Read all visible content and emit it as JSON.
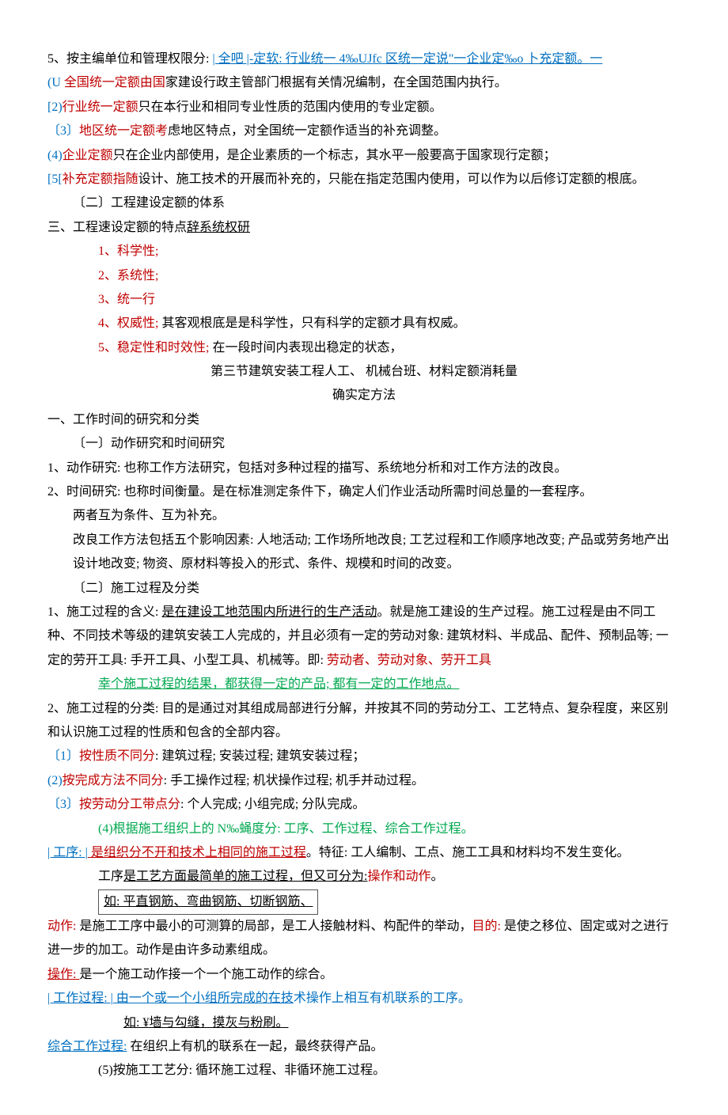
{
  "p5_lead": "5、按主编单位和管理权限分: ",
  "p5_link": "| 全吧 |-定软: 行业统一 4‰UJfc 区统一定说\"一企业定‰o 卜充定额。一",
  "p5_1a": "(U ",
  "p5_1b": "全国统一定额由国",
  "p5_1c": "家建设行政主管部门根据有关情况编制，在全国范围内执行。",
  "p5_2a": "[2)",
  "p5_2b": "行业统一定额",
  "p5_2c": "只在本行业和相同专业性质的范围内使用的专业定额。",
  "p5_3a": "〔3〕",
  "p5_3b": "地区统一定额考",
  "p5_3c": "虑地区特点，对全国统一定额作适当的补充调整。",
  "p5_4a": "(4)",
  "p5_4b": "企业定额",
  "p5_4c": "只在企业内部使用，是企业素质的一个标志，其水平一般要高于国家现行定额；",
  "p5_5a": "[5[",
  "p5_5b": "补充定额指随",
  "p5_5c": "设计、施工技术的开展而补充的，只能在指定范围内使用，可以作为以后修订定额的根底。",
  "sec2": "〔二〕工程建设定额的体系",
  "sec3a": "三、工程速设定额的特点",
  "sec3b": "辞系统权研",
  "pt1a": "1、科学性; ",
  "pt2a": "2、系统性; ",
  "pt3a": "3、统一行",
  "pt4a": "4、权威性; ",
  "pt4b": "其客观根底是是科学性，只有科学的定额才具有权威。",
  "pt5a": "5、稳定性和时效性; ",
  "pt5b": "在一段时间内表现出稳定的状态，",
  "title1": "第三节建筑安装工程人工、 机械台班、材料定额消耗量",
  "title2": "确实定方法",
  "s1": "一、工作时间的研究和分类",
  "s1_1": "〔一〕动作研究和时间研究",
  "s1_p1": "1、动作研究: 也称工作方法研究，包括对多种过程的描写、系统地分析和对工作方法的改良。",
  "s1_p2": "2、时间研究: 也称时间衡量。是在标准测定条件下，确定人们作业活动所需时间总量的一套程序。",
  "s1_p3": "两者互为条件、互为补充。",
  "s1_p4": "改良工作方法包括五个影响因素: 人地活动; 工作场所地改良; 工艺过程和工作顺序地改变; 产品或劳务地产出设计地改变; 物资、原材料等投入的形式、条件、规模和时间的改变。",
  "s1_2": "〔二〕施工过程及分类",
  "s2_p1a": "1、施工过程的含义: ",
  "s2_p1b": "是在建设工地范围内所进行的生产活动",
  "s2_p1c": "。就是施工建设的生产过程。施工过程是由不同工种、不同技术等级的建筑安装工人完成的，并且必须有一定的劳动对象: 建筑材料、半成品、配件、预制品等; 一定的劳开工具: 手开工具、小型工具、机械等。即: ",
  "s2_p1d": "劳动者、劳动对象、劳开工具",
  "s2_p2": "幸个施工过程的结果，都获得一定的产品; 都有一定的工作地点。",
  "s2_p3": "2、施工过程的分类: 目的是通过对其组成局部进行分解，并按其不同的劳动分工、工艺特点、复杂程度，来区别和认识施工过程的性质和包含的全部内容。",
  "s2_c1a": "〔1〕",
  "s2_c1b": "按性质不同分",
  "s2_c1c": ": 建筑过程; 安装过程; 建筑安装过程；",
  "s2_c2a": "(2)",
  "s2_c2b": "按完成方法不同分",
  "s2_c2c": ": 手工操作过程; 机状操作过程; 机手并动过程。",
  "s2_c3a": "〔3〕",
  "s2_c3b": "按劳动分工带点分",
  "s2_c3c": ": 个人完成; 小组完成; 分队完成。",
  "s2_c4a": "(4)根据施工组织上的 N‰蝇度分: ",
  "s2_c4b": "工序、工作过程、综合工作过程。",
  "gx_a": "| 工序: |",
  "gx_b": " 是组织分不开和技术上相同的施工过程",
  "gx_c": "。特征: 工人编制、工点、施工工具和材料均不发生变化。",
  "gx_d1": "工序",
  "gx_d2": "是工艺方面最简单的施工过程，但又可分为:",
  "gx_d3": "操作和动作",
  "gx_d4": "。",
  "gx_box": "如: 平直钢筋、弯曲钢筋、切断钢筋、",
  "dz_a": "动作: ",
  "dz_b": "是施工工序中最小的可测算的局部，是工人接触材料、构配件的举动，",
  "dz_c": "目的: ",
  "dz_d": "是使之移位、固定或对之进行进一步的加工。动作是由许多动素组成。",
  "cz_a": "操作: ",
  "cz_b": "是一个施工动作接一个一个施工动作的综合。",
  "gzgc_a": "| 工作过程: |",
  "gzgc_b": " 由一个或一个小组所完成的在技",
  "gzgc_c": "术操作上相互有机联系的工序。",
  "gzgc_ex": "如: ¥墙与勾缝，摸灰与粉刷。",
  "zh_a": "综合工作过程:",
  "zh_b": " 在组织上有机的联系在一起，最终获得产品。",
  "c5": "(5)按施工工艺分: 循环施工过程、非循环施工过程。"
}
